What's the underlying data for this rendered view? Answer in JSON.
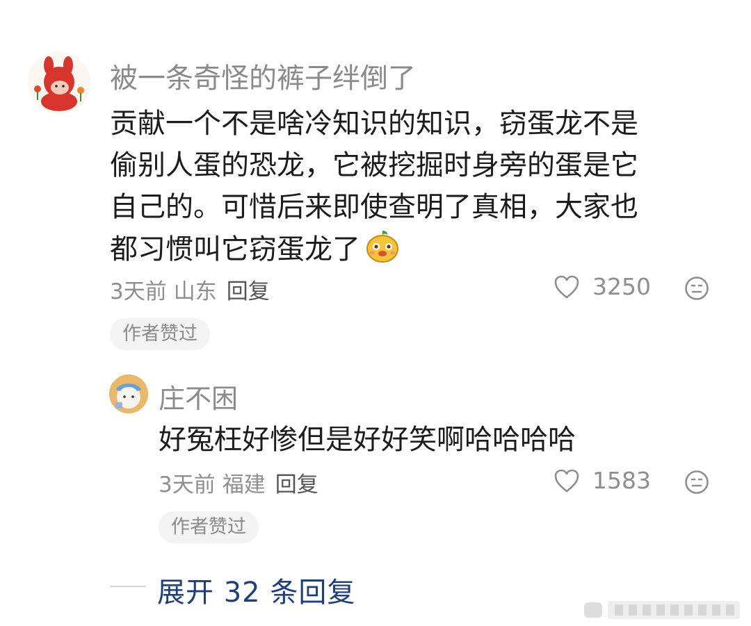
{
  "comment": {
    "username": "被一条奇怪的裤子绊倒了",
    "content_lines": [
      "贡献一个不是啥冷知识的知识，窃蛋龙不是",
      "偷别人蛋的恐龙，它被挖掘时身旁的蛋是它",
      "自己的。可惜后来即使查明了真相，大家也",
      "都习惯叫它窃蛋龙了"
    ],
    "time": "3天前",
    "location": "山东",
    "reply_label": "回复",
    "likes": "3250",
    "badge": "作者赞过"
  },
  "reply": {
    "username": "庄不困",
    "content": "好冤枉好惨但是好好笑啊哈哈哈哈",
    "time": "3天前",
    "location": "福建",
    "reply_label": "回复",
    "likes": "1583",
    "badge": "作者赞过"
  },
  "expand_label": "展开 32 条回复",
  "icons": {
    "like": "heart-outline-icon",
    "dislike": "frown-face-icon",
    "emoji": "yellow-cartoon-emoji"
  },
  "colors": {
    "link": "#1f3f7a",
    "meta": "#8e8e8e",
    "badge_bg": "#f3f3f3"
  }
}
